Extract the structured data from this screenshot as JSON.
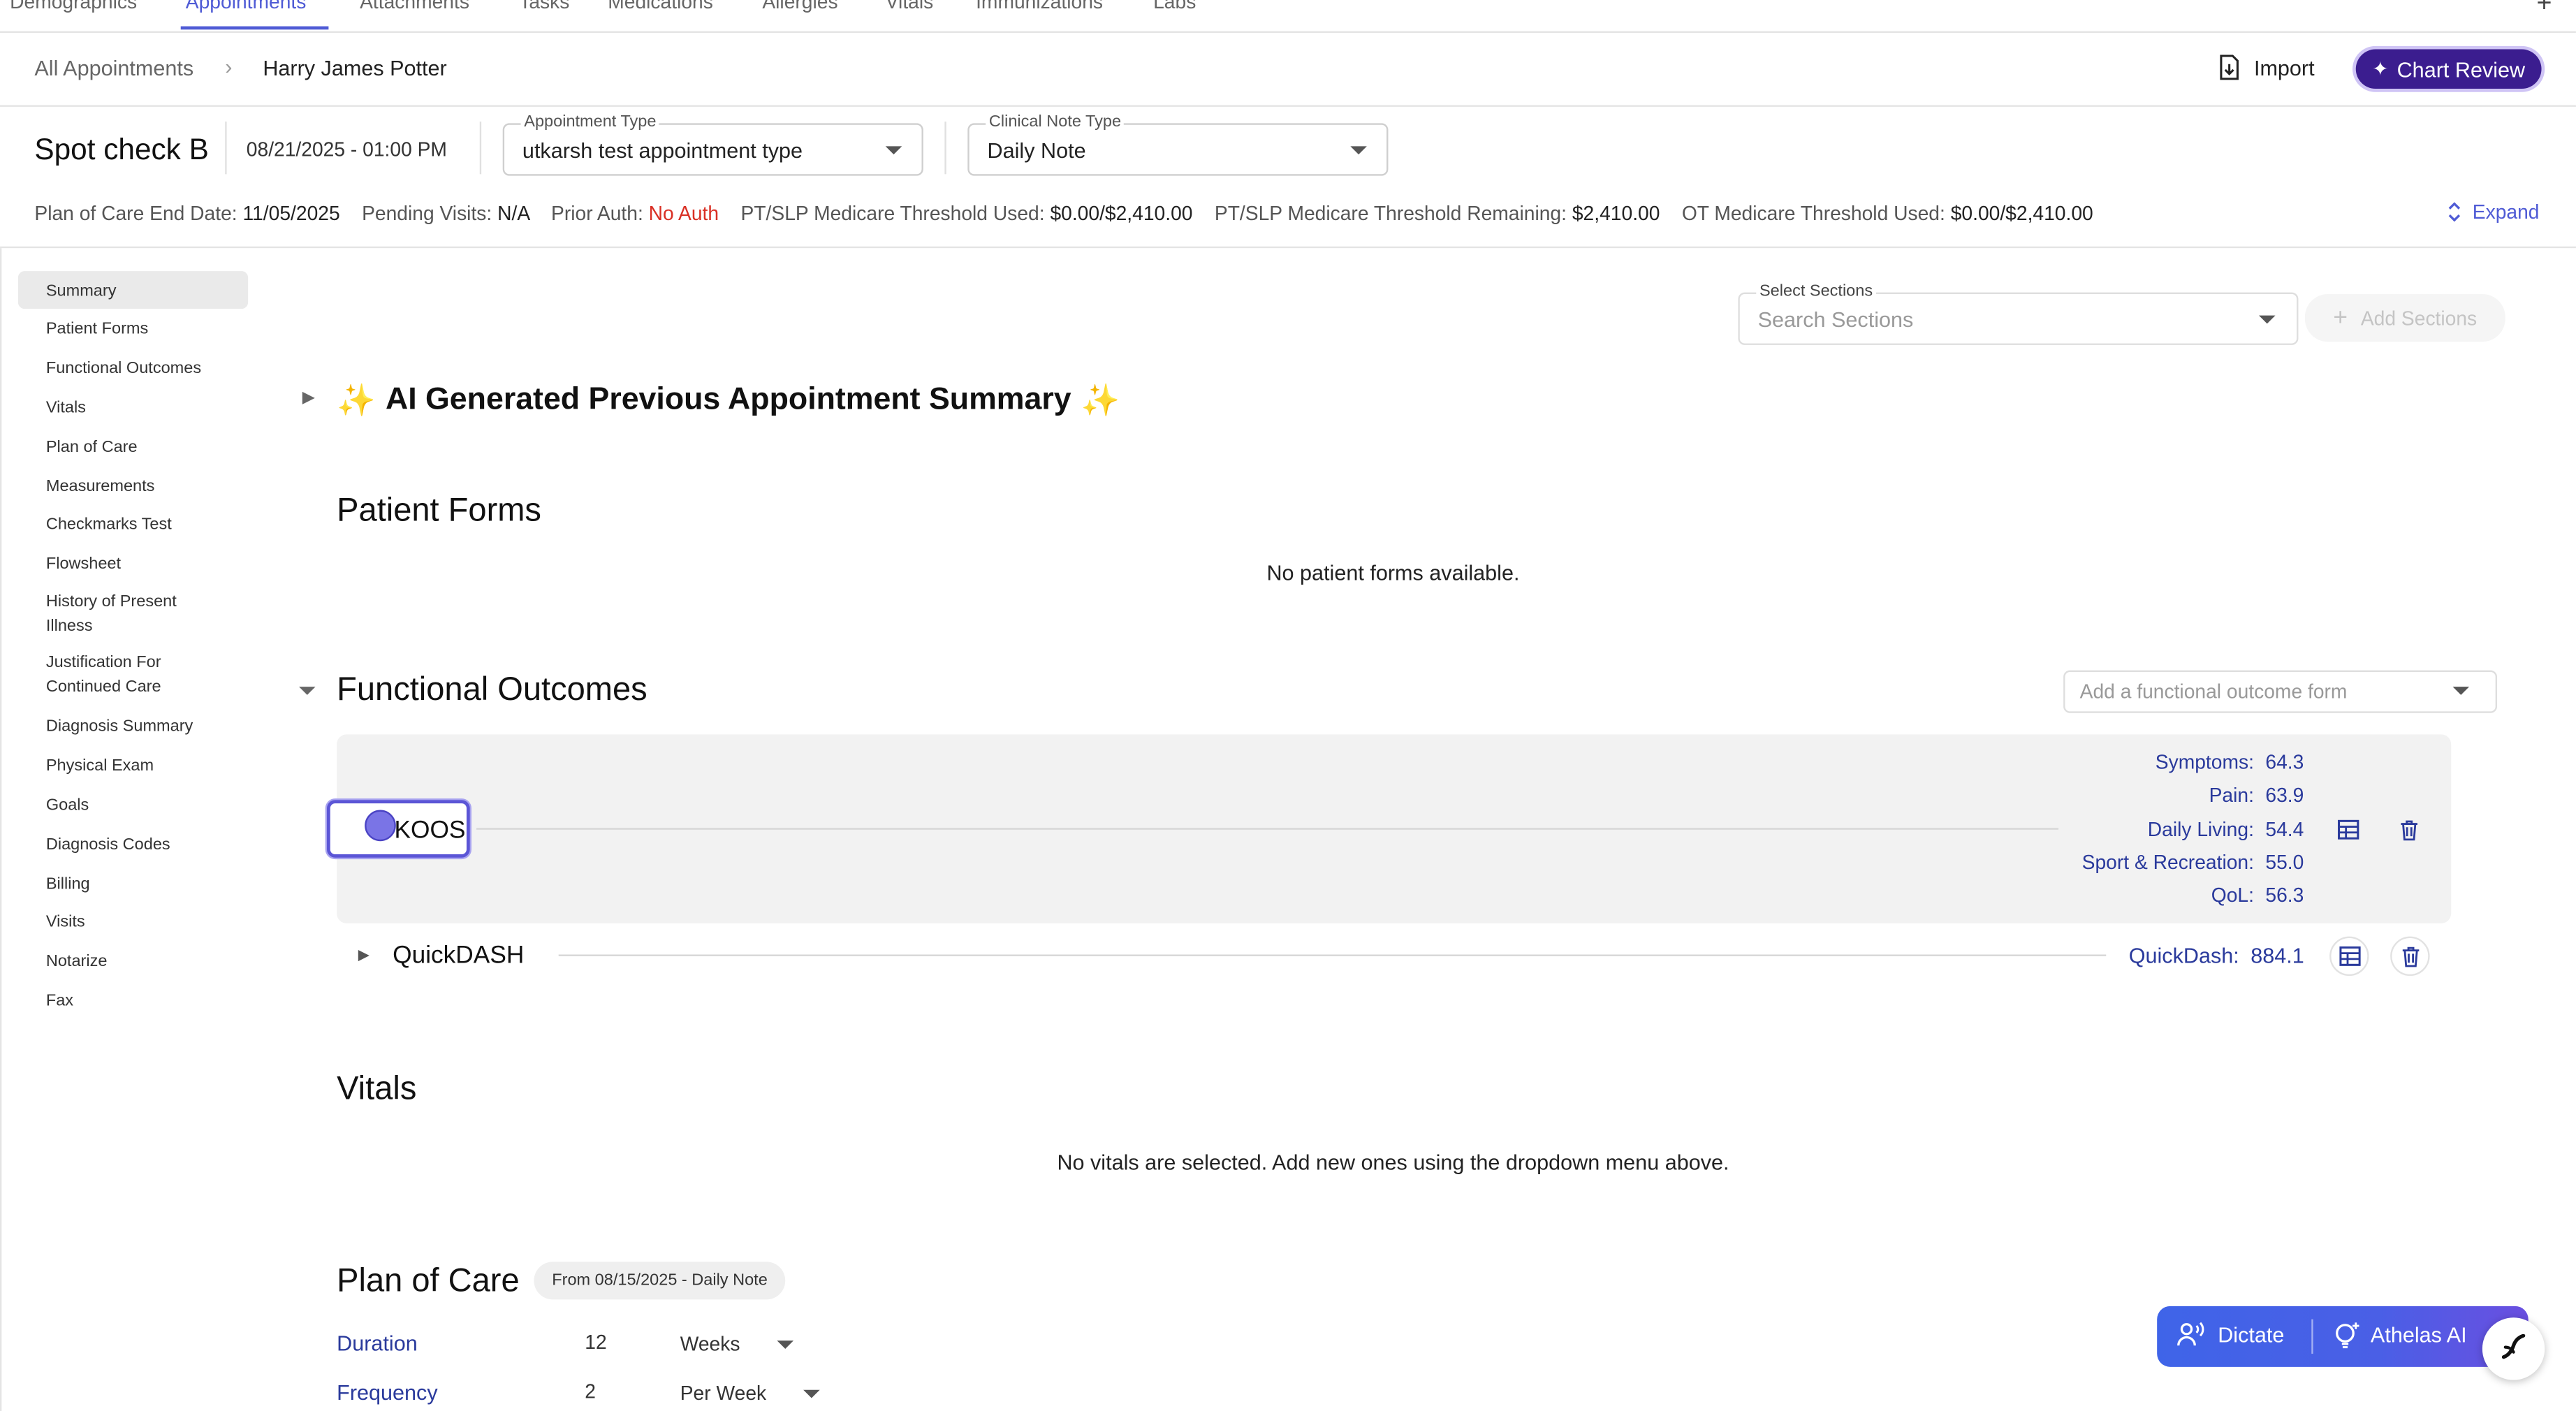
{
  "nav": {
    "tabs": [
      "Demographics",
      "Appointments",
      "Attachments",
      "Tasks",
      "Medications",
      "Allergies",
      "Vitals",
      "Immunizations",
      "Labs"
    ],
    "active": "Appointments",
    "plus_icon": "plus-icon"
  },
  "breadcrumb": {
    "root": "All Appointments",
    "current": "Harry James Potter"
  },
  "header": {
    "import_label": "Import",
    "chart_review_label": "Chart Review"
  },
  "appointment": {
    "title": "Spot check B",
    "datetime": "08/21/2025 - 01:00 PM",
    "appointment_type_label": "Appointment Type",
    "appointment_type_value": "utkarsh test appointment type",
    "clinical_note_type_label": "Clinical Note Type",
    "clinical_note_type_value": "Daily Note"
  },
  "info_bar": {
    "poc_end_label": "Plan of Care End Date:",
    "poc_end_value": "11/05/2025",
    "pending_label": "Pending Visits:",
    "pending_value": "N/A",
    "prior_auth_label": "Prior Auth:",
    "prior_auth_value": "No Auth",
    "ptslp_used_label": "PT/SLP Medicare Threshold Used:",
    "ptslp_used_value": "$0.00/$2,410.00",
    "ptslp_rem_label": "PT/SLP Medicare Threshold Remaining:",
    "ptslp_rem_value": "$2,410.00",
    "ot_used_label": "OT Medicare Threshold Used:",
    "ot_used_value": "$0.00/$2,410.00",
    "expand_label": "Expand"
  },
  "sidebar": {
    "items": [
      "Summary",
      "Patient Forms",
      "Functional Outcomes",
      "Vitals",
      "Plan of Care",
      "Measurements",
      "Checkmarks Test",
      "Flowsheet",
      "History of Present Illness",
      "Justification For Continued Care",
      "Diagnosis Summary",
      "Physical Exam",
      "Goals",
      "Diagnosis Codes",
      "Billing",
      "Visits",
      "Notarize",
      "Fax"
    ],
    "active": "Summary"
  },
  "sections_select": {
    "label": "Select Sections",
    "placeholder": "Search Sections",
    "add_label": "Add Sections"
  },
  "ai_summary": {
    "title": "AI Generated Previous Appointment Summary",
    "sparkle": "✨"
  },
  "patient_forms": {
    "title": "Patient Forms",
    "empty": "No patient forms available."
  },
  "functional_outcomes": {
    "title": "Functional Outcomes",
    "add_placeholder": "Add a functional outcome form",
    "koos": {
      "name": "KOOS",
      "metrics": [
        {
          "label": "Symptoms:",
          "value": "64.3"
        },
        {
          "label": "Pain:",
          "value": "63.9"
        },
        {
          "label": "Daily Living:",
          "value": "54.4"
        },
        {
          "label": "Sport & Recreation:",
          "value": "55.0"
        },
        {
          "label": "QoL:",
          "value": "56.3"
        }
      ]
    },
    "quickdash": {
      "name": "QuickDASH",
      "metric_label": "QuickDash:",
      "metric_value": "884.1"
    }
  },
  "vitals": {
    "title": "Vitals",
    "empty": "No vitals are selected. Add new ones using the dropdown menu above."
  },
  "plan_of_care": {
    "title": "Plan of Care",
    "badge": "From 08/15/2025 - Daily Note",
    "duration_label": "Duration",
    "duration_value": "12",
    "duration_unit": "Weeks",
    "frequency_label": "Frequency",
    "frequency_value": "2",
    "frequency_unit": "Per Week"
  },
  "floating": {
    "dictate_label": "Dictate",
    "athelas_label": "Athelas AI"
  },
  "colors": {
    "accent": "#4f5bd5",
    "chart_review_bg": "#3b1d8f",
    "metric_text": "#2a3a9c",
    "alert_red": "#d93025",
    "dictate_bg": "#3f64e8"
  }
}
